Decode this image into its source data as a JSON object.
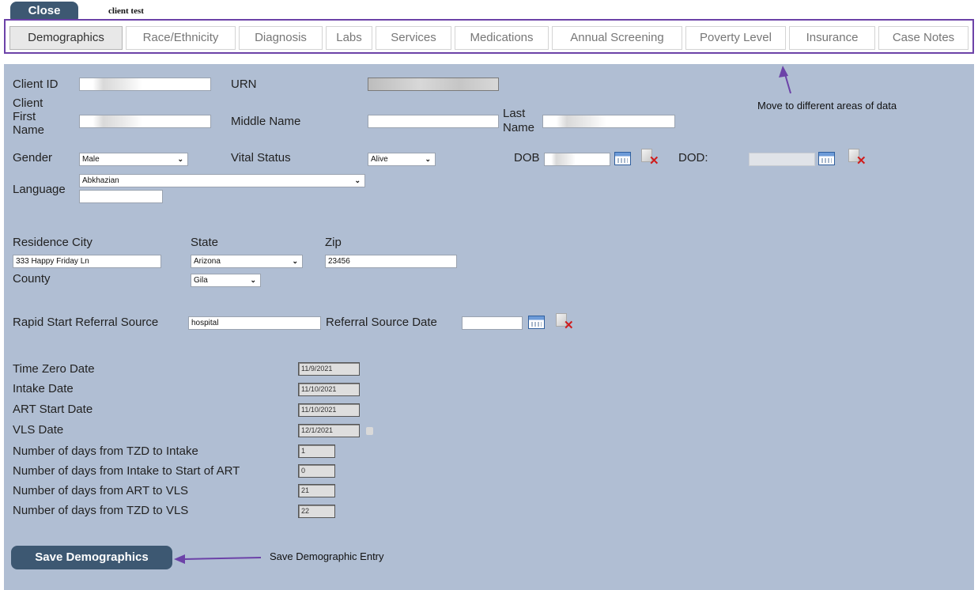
{
  "header": {
    "close_label": "Close",
    "client_name": "client test"
  },
  "tabs": [
    "Demographics",
    "Race/Ethnicity",
    "Diagnosis",
    "Labs",
    "Services",
    "Medications",
    "Annual Screening",
    "Poverty Level",
    "Insurance",
    "Case Notes"
  ],
  "active_tab": "Demographics",
  "annotations": {
    "tabs_note": "Move to different areas of data",
    "save_note": "Save Demographic Entry",
    "color": "#6c42a8"
  },
  "form": {
    "client_id_label": "Client ID",
    "urn_label": "URN",
    "first_name_label_l1": "Client",
    "first_name_label_l2": "First",
    "first_name_label_l3": "Name",
    "middle_name_label": "Middle Name",
    "last_name_label_l1": "Last",
    "last_name_label_l2": "Name",
    "gender_label": "Gender",
    "gender_value": "Male",
    "vital_status_label": "Vital Status",
    "vital_status_value": "Alive",
    "dob_label": "DOB",
    "dod_label": "DOD:",
    "language_label": "Language",
    "language_value": "Abkhazian",
    "residence_city_label": "Residence City",
    "residence_city_value": "333 Happy Friday Ln",
    "state_label": "State",
    "state_value": "Arizona",
    "zip_label": "Zip",
    "zip_value": "23456",
    "county_label": "County",
    "county_value": "Gila",
    "referral_source_label": "Rapid Start Referral Source",
    "referral_source_value": "hospital",
    "referral_date_label": "Referral Source Date"
  },
  "dates": [
    {
      "label": "Time Zero Date",
      "value": "11/9/2021"
    },
    {
      "label": "Intake Date",
      "value": "11/10/2021"
    },
    {
      "label": "ART Start Date",
      "value": "11/10/2021"
    },
    {
      "label": "VLS Date",
      "value": "12/1/2021"
    }
  ],
  "day_counts": [
    {
      "label": "Number of days from TZD to Intake",
      "value": "1"
    },
    {
      "label": "Number of days from Intake to Start of ART",
      "value": "0"
    },
    {
      "label": "Number of days from ART to VLS",
      "value": "21"
    },
    {
      "label": "Number of days from TZD to VLS",
      "value": "22"
    }
  ],
  "save_label": "Save Demographics",
  "colors": {
    "panel_bg": "#b0bed3",
    "button_bg": "#3d5872",
    "accent": "#6c42a8"
  }
}
